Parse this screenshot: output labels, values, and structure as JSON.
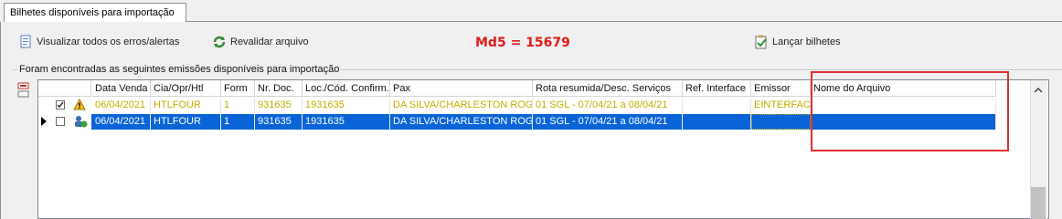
{
  "tab": {
    "label": "Bilhetes disponíveis para importação"
  },
  "toolbar": {
    "view_errors_label": "Visualizar todos os erros/alertas",
    "revalidate_label": "Revalidar arquivo",
    "md5_text": "Md5 = 15679",
    "launch_label": "Lançar bilhetes"
  },
  "group": {
    "title": "Foram encontradas as seguintes emissões disponíveis para importação"
  },
  "grid": {
    "headers": [
      "Data Venda",
      "Cia/Opr/Htl",
      "Form",
      "Nr. Doc.",
      "Loc./Cód. Confirm.",
      "Pax",
      "Rota resumida/Desc. Serviços",
      "Ref. Interface",
      "Emissor",
      "Nome do Arquivo"
    ],
    "rows": [
      {
        "checked": true,
        "status_icon": "warning-icon",
        "data_venda": "06/04/2021",
        "cia": "HTLFOUR",
        "form": "1",
        "nr_doc": "931635",
        "loc": "1931635",
        "pax": "DA SILVA/CHARLESTON ROG",
        "rota": "01 SGL - 07/04/21 a 08/04/21",
        "ref_interface": "",
        "emissor": "EINTERFAC",
        "nome_arquivo": ""
      },
      {
        "checked": false,
        "selected": true,
        "status_icon": "ok-user-icon",
        "data_venda": "06/04/2021",
        "cia": "HTLFOUR",
        "form": "1",
        "nr_doc": "931635",
        "loc": "1931635",
        "pax": "DA SILVA/CHARLESTON ROG",
        "rota": "01 SGL - 07/04/21 a 08/04/21",
        "ref_interface": "",
        "emissor": "",
        "nome_arquivo": ""
      }
    ]
  },
  "colors": {
    "md5": "#e01b1b",
    "selection": "#0a64d8",
    "warning_text": "#c0b000",
    "highlight_box": "#e03030"
  }
}
